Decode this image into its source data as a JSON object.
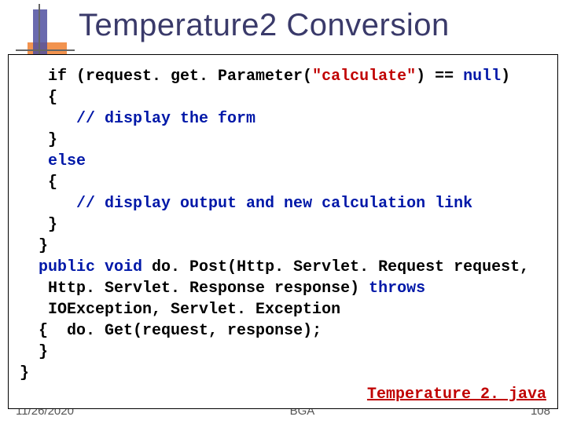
{
  "title": "Temperature2 Conversion",
  "code": {
    "l1a": "   if (request. get. Parameter(",
    "l1str": "\"calculate\"",
    "l1b": ") == ",
    "l1null": "null",
    "l1c": ")",
    "l2": "   {",
    "l3a": "      ",
    "l3b": "// display the form",
    "l4": "   }",
    "l5a": "   ",
    "l5else": "else",
    "l6": "   {",
    "l7a": "      ",
    "l7b": "// display output and new calculation link",
    "l8": "   }",
    "l9": "}",
    "l10a": "public void",
    "l10b": " do. Post(Http. Servlet. Request request,",
    "l11a": "   Http. Servlet. Response response) ",
    "l11throws": "throws",
    "l12": "   IOException, Servlet. Exception",
    "l13": "{  do. Get(request, response);",
    "l14": "}"
  },
  "outer_brace": "}",
  "file_link": "Temperature 2. java",
  "footer": {
    "date": "11/26/2020",
    "center": "BGA",
    "pagenum": "108"
  }
}
